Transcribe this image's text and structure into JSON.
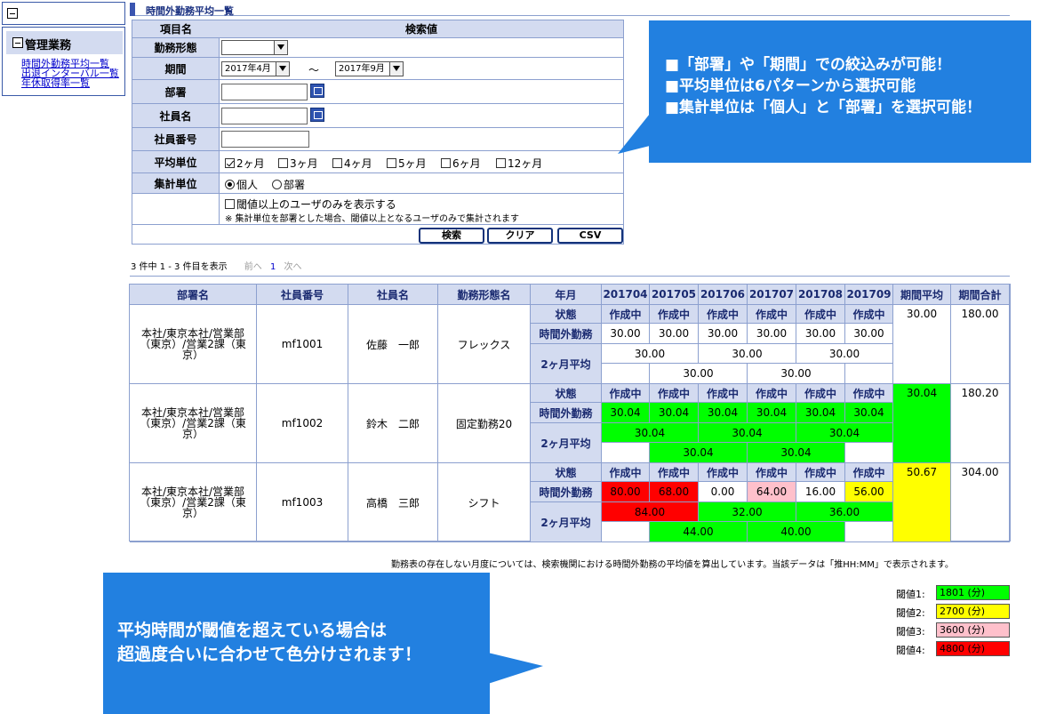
{
  "sidebar": {
    "section_title": "管理業務",
    "links": [
      "時間外勤務平均一覧",
      "出退インターバル一覧",
      "年休取得率一覧"
    ]
  },
  "page_title": "時間外勤務平均一覧",
  "form": {
    "header_item": "項目名",
    "header_value": "検索値",
    "work_type_label": "勤務形態",
    "work_type_value": "",
    "period_label": "期間",
    "period_from": "2017年4月",
    "period_sep": "～",
    "period_to": "2017年9月",
    "dept_label": "部署",
    "name_label": "社員名",
    "empno_label": "社員番号",
    "avg_unit_label": "平均単位",
    "avg_units": [
      {
        "label": "2ヶ月",
        "checked": true
      },
      {
        "label": "3ヶ月",
        "checked": false
      },
      {
        "label": "4ヶ月",
        "checked": false
      },
      {
        "label": "5ヶ月",
        "checked": false
      },
      {
        "label": "6ヶ月",
        "checked": false
      },
      {
        "label": "12ヶ月",
        "checked": false
      }
    ],
    "agg_unit_label": "集計単位",
    "agg_individual": "個人",
    "agg_dept": "部署",
    "threshold_only": "閾値以上のユーザのみを表示する",
    "threshold_note": "※ 集計単位を部署とした場合、閾値以上となるユーザのみで集計されます",
    "btn_search": "検索",
    "btn_clear": "クリア",
    "btn_csv": "CSV"
  },
  "callout_top": {
    "lines": [
      "■「部署」や「期間」での絞込みが可能！",
      "■平均単位は6パターンから選択可能",
      "■集計単位は「個人」と「部署」を選択可能！"
    ]
  },
  "pager": {
    "summary": "3 件中 1 - 3 件目を表示",
    "prev": "前へ",
    "current": "1",
    "next": "次へ"
  },
  "table": {
    "headers": [
      "部署名",
      "社員番号",
      "社員名",
      "勤務形態名",
      "年月",
      "201704",
      "201705",
      "201706",
      "201707",
      "201708",
      "201709",
      "期間平均",
      "期間合計"
    ],
    "sub_labels": [
      "状態",
      "時間外勤務",
      "2ヶ月平均"
    ],
    "rows": [
      {
        "dept": "本社/東京本社/営業部（東京）/営業2課（東京）",
        "empno": "mf1001",
        "name": "佐藤　一郎",
        "worktype": "フレックス",
        "status": [
          "作成中",
          "作成中",
          "作成中",
          "作成中",
          "作成中",
          "作成中"
        ],
        "overtime": [
          "30.00",
          "30.00",
          "30.00",
          "30.00",
          "30.00",
          "30.00"
        ],
        "overtime_colors": [
          "#ffffff",
          "#ffffff",
          "#ffffff",
          "#ffffff",
          "#ffffff",
          "#ffffff"
        ],
        "avg_a": [
          "30.00",
          "30.00",
          "30.00"
        ],
        "avg_a_colors": [
          "#ffffff",
          "#ffffff",
          "#ffffff"
        ],
        "avg_b": [
          "30.00",
          "30.00"
        ],
        "avg_b_colors": [
          "#ffffff",
          "#ffffff"
        ],
        "period_avg": "30.00",
        "period_avg_color": "#ffffff",
        "period_total": "180.00"
      },
      {
        "dept": "本社/東京本社/営業部（東京）/営業2課（東京）",
        "empno": "mf1002",
        "name": "鈴木　二郎",
        "worktype": "固定勤務20",
        "status": [
          "作成中",
          "作成中",
          "作成中",
          "作成中",
          "作成中",
          "作成中"
        ],
        "overtime": [
          "30.04",
          "30.04",
          "30.04",
          "30.04",
          "30.04",
          "30.04"
        ],
        "overtime_colors": [
          "#00ff00",
          "#00ff00",
          "#00ff00",
          "#00ff00",
          "#00ff00",
          "#00ff00"
        ],
        "avg_a": [
          "30.04",
          "30.04",
          "30.04"
        ],
        "avg_a_colors": [
          "#00ff00",
          "#00ff00",
          "#00ff00"
        ],
        "avg_b": [
          "30.04",
          "30.04"
        ],
        "avg_b_colors": [
          "#00ff00",
          "#00ff00"
        ],
        "period_avg": "30.04",
        "period_avg_color": "#00ff00",
        "period_total": "180.20"
      },
      {
        "dept": "本社/東京本社/営業部（東京）/営業2課（東京）",
        "empno": "mf1003",
        "name": "高橋　三郎",
        "worktype": "シフト",
        "status": [
          "作成中",
          "作成中",
          "作成中",
          "作成中",
          "作成中",
          "作成中"
        ],
        "overtime": [
          "80.00",
          "68.00",
          "0.00",
          "64.00",
          "16.00",
          "56.00"
        ],
        "overtime_colors": [
          "#ff0000",
          "#ff0000",
          "#ffffff",
          "#ffc0cb",
          "#ffffff",
          "#ffff00"
        ],
        "avg_a": [
          "84.00",
          "32.00",
          "36.00"
        ],
        "avg_a_colors": [
          "#ff0000",
          "#00ff00",
          "#00ff00"
        ],
        "avg_b": [
          "44.00",
          "40.00"
        ],
        "avg_b_colors": [
          "#00ff00",
          "#00ff00"
        ],
        "period_avg": "50.67",
        "period_avg_color": "#ffff00",
        "period_total": "304.00"
      }
    ]
  },
  "note": "勤務表の存在しない月度については、検索機関における時間外勤務の平均値を算出しています。当該データは「推HH:MM」で表示されます。",
  "thresholds": [
    {
      "label": "閾値1:",
      "value": "1801 (分)",
      "color": "#00ff00"
    },
    {
      "label": "閾値2:",
      "value": "2700 (分)",
      "color": "#ffff00"
    },
    {
      "label": "閾値3:",
      "value": "3600 (分)",
      "color": "#ffc0cb"
    },
    {
      "label": "閾値4:",
      "value": "4800 (分)",
      "color": "#ff0000"
    }
  ],
  "callout_bottom": {
    "lines": [
      "平均時間が閾値を超えている場合は",
      "超過度合いに合わせて色分けされます！"
    ]
  }
}
